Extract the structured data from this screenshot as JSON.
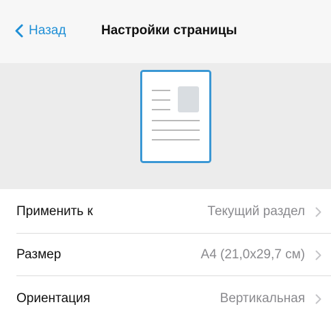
{
  "navbar": {
    "back_label": "Назад",
    "title": "Настройки страницы",
    "accent_color": "#1f8fd6"
  },
  "preview": {
    "icon": "page-layout-icon"
  },
  "settings": {
    "rows": [
      {
        "label": "Применить к",
        "value": "Текущий раздел"
      },
      {
        "label": "Размер",
        "value": "А4 (21,0x29,7 см)"
      },
      {
        "label": "Ориентация",
        "value": "Вертикальная"
      }
    ]
  }
}
